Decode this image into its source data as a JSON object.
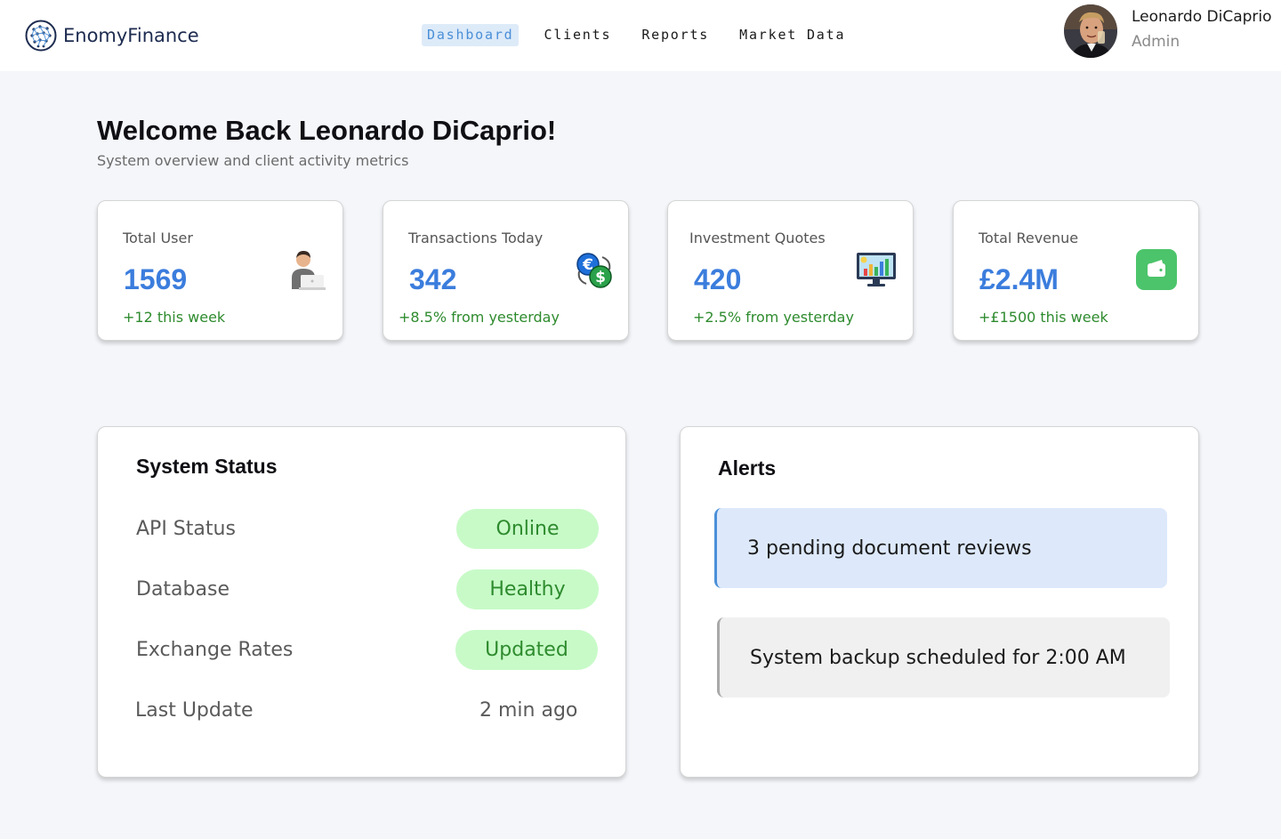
{
  "brand": {
    "name": "EnomyFinance",
    "logo_icon": "network-globe-icon"
  },
  "nav": {
    "items": [
      {
        "label": "Dashboard",
        "active": true
      },
      {
        "label": "Clients",
        "active": false
      },
      {
        "label": "Reports",
        "active": false
      },
      {
        "label": "Market Data",
        "active": false
      }
    ]
  },
  "user": {
    "name": "Leonardo DiCaprio",
    "role": "Admin",
    "avatar_icon": "user-avatar-photo"
  },
  "welcome": {
    "title": "Welcome Back Leonardo DiCaprio!",
    "subtitle": "System overview and client activity metrics"
  },
  "stats": [
    {
      "label": "Total User",
      "value": "1569",
      "change": "+12 this week",
      "icon": "person-laptop-icon"
    },
    {
      "label": "Transactions Today",
      "value": "342",
      "change": "+8.5% from yesterday",
      "icon": "currency-exchange-icon"
    },
    {
      "label": "Investment Quotes",
      "value": "420",
      "change": "+2.5% from yesterday",
      "icon": "monitor-chart-icon"
    },
    {
      "label": "Total Revenue",
      "value": "£2.4M",
      "change": "+£1500 this week",
      "icon": "wallet-icon"
    }
  ],
  "system_status": {
    "title": "System Status",
    "rows": [
      {
        "label": "API Status",
        "value": "Online"
      },
      {
        "label": "Database",
        "value": "Healthy"
      },
      {
        "label": "Exchange Rates",
        "value": "Updated"
      },
      {
        "label": "Last Update",
        "value": "2 min ago"
      }
    ]
  },
  "alerts": {
    "title": "Alerts",
    "items": [
      {
        "text": "3 pending document reviews",
        "type": "info"
      },
      {
        "text": "System backup scheduled for 2:00 AM",
        "type": "neutral"
      }
    ]
  },
  "colors": {
    "accent": "#3b7ddd",
    "positive": "#2e8b2e",
    "pill_bg": "#c8fac8",
    "alert_info_bg": "#dde9fb",
    "alert_neutral_bg": "#f1f0f0",
    "wallet_green": "#4cc46b"
  }
}
